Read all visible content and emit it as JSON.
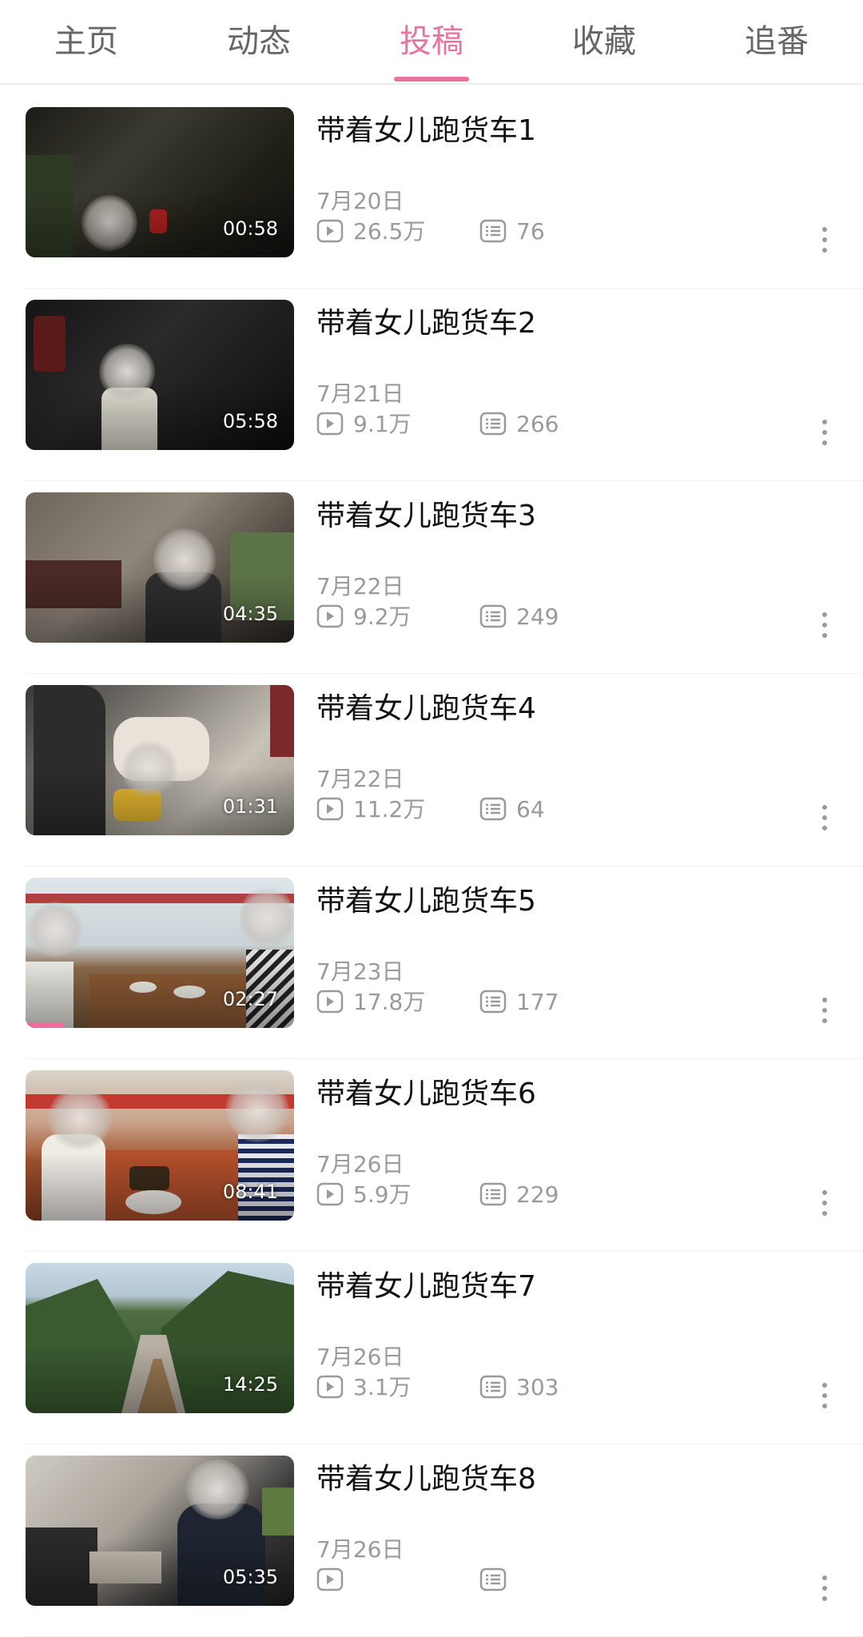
{
  "tabs": [
    {
      "label": "主页",
      "active": false
    },
    {
      "label": "动态",
      "active": false
    },
    {
      "label": "投稿",
      "active": true
    },
    {
      "label": "收藏",
      "active": false
    },
    {
      "label": "追番",
      "active": false
    }
  ],
  "colors": {
    "accent": "#e8739c",
    "meta_text": "#9a9a9a"
  },
  "videos": [
    {
      "title": "带着女儿跑货车1",
      "date": "7月20日",
      "views": "26.5万",
      "comments": "76",
      "duration": "00:58"
    },
    {
      "title": "带着女儿跑货车2",
      "date": "7月21日",
      "views": "9.1万",
      "comments": "266",
      "duration": "05:58"
    },
    {
      "title": "带着女儿跑货车3",
      "date": "7月22日",
      "views": "9.2万",
      "comments": "249",
      "duration": "04:35"
    },
    {
      "title": "带着女儿跑货车4",
      "date": "7月22日",
      "views": "11.2万",
      "comments": "64",
      "duration": "01:31"
    },
    {
      "title": "带着女儿跑货车5",
      "date": "7月23日",
      "views": "17.8万",
      "comments": "177",
      "duration": "02:27",
      "watch_progress": 0.14
    },
    {
      "title": "带着女儿跑货车6",
      "date": "7月26日",
      "views": "5.9万",
      "comments": "229",
      "duration": "08:41"
    },
    {
      "title": "带着女儿跑货车7",
      "date": "7月26日",
      "views": "3.1万",
      "comments": "303",
      "duration": "14:25"
    },
    {
      "title": "带着女儿跑货车8",
      "date": "7月26日",
      "views": "",
      "comments": "",
      "duration": "05:35"
    }
  ],
  "icons": {
    "views": "play-count-icon",
    "comments": "danmaku-comment-icon",
    "more": "more-vertical-icon"
  }
}
